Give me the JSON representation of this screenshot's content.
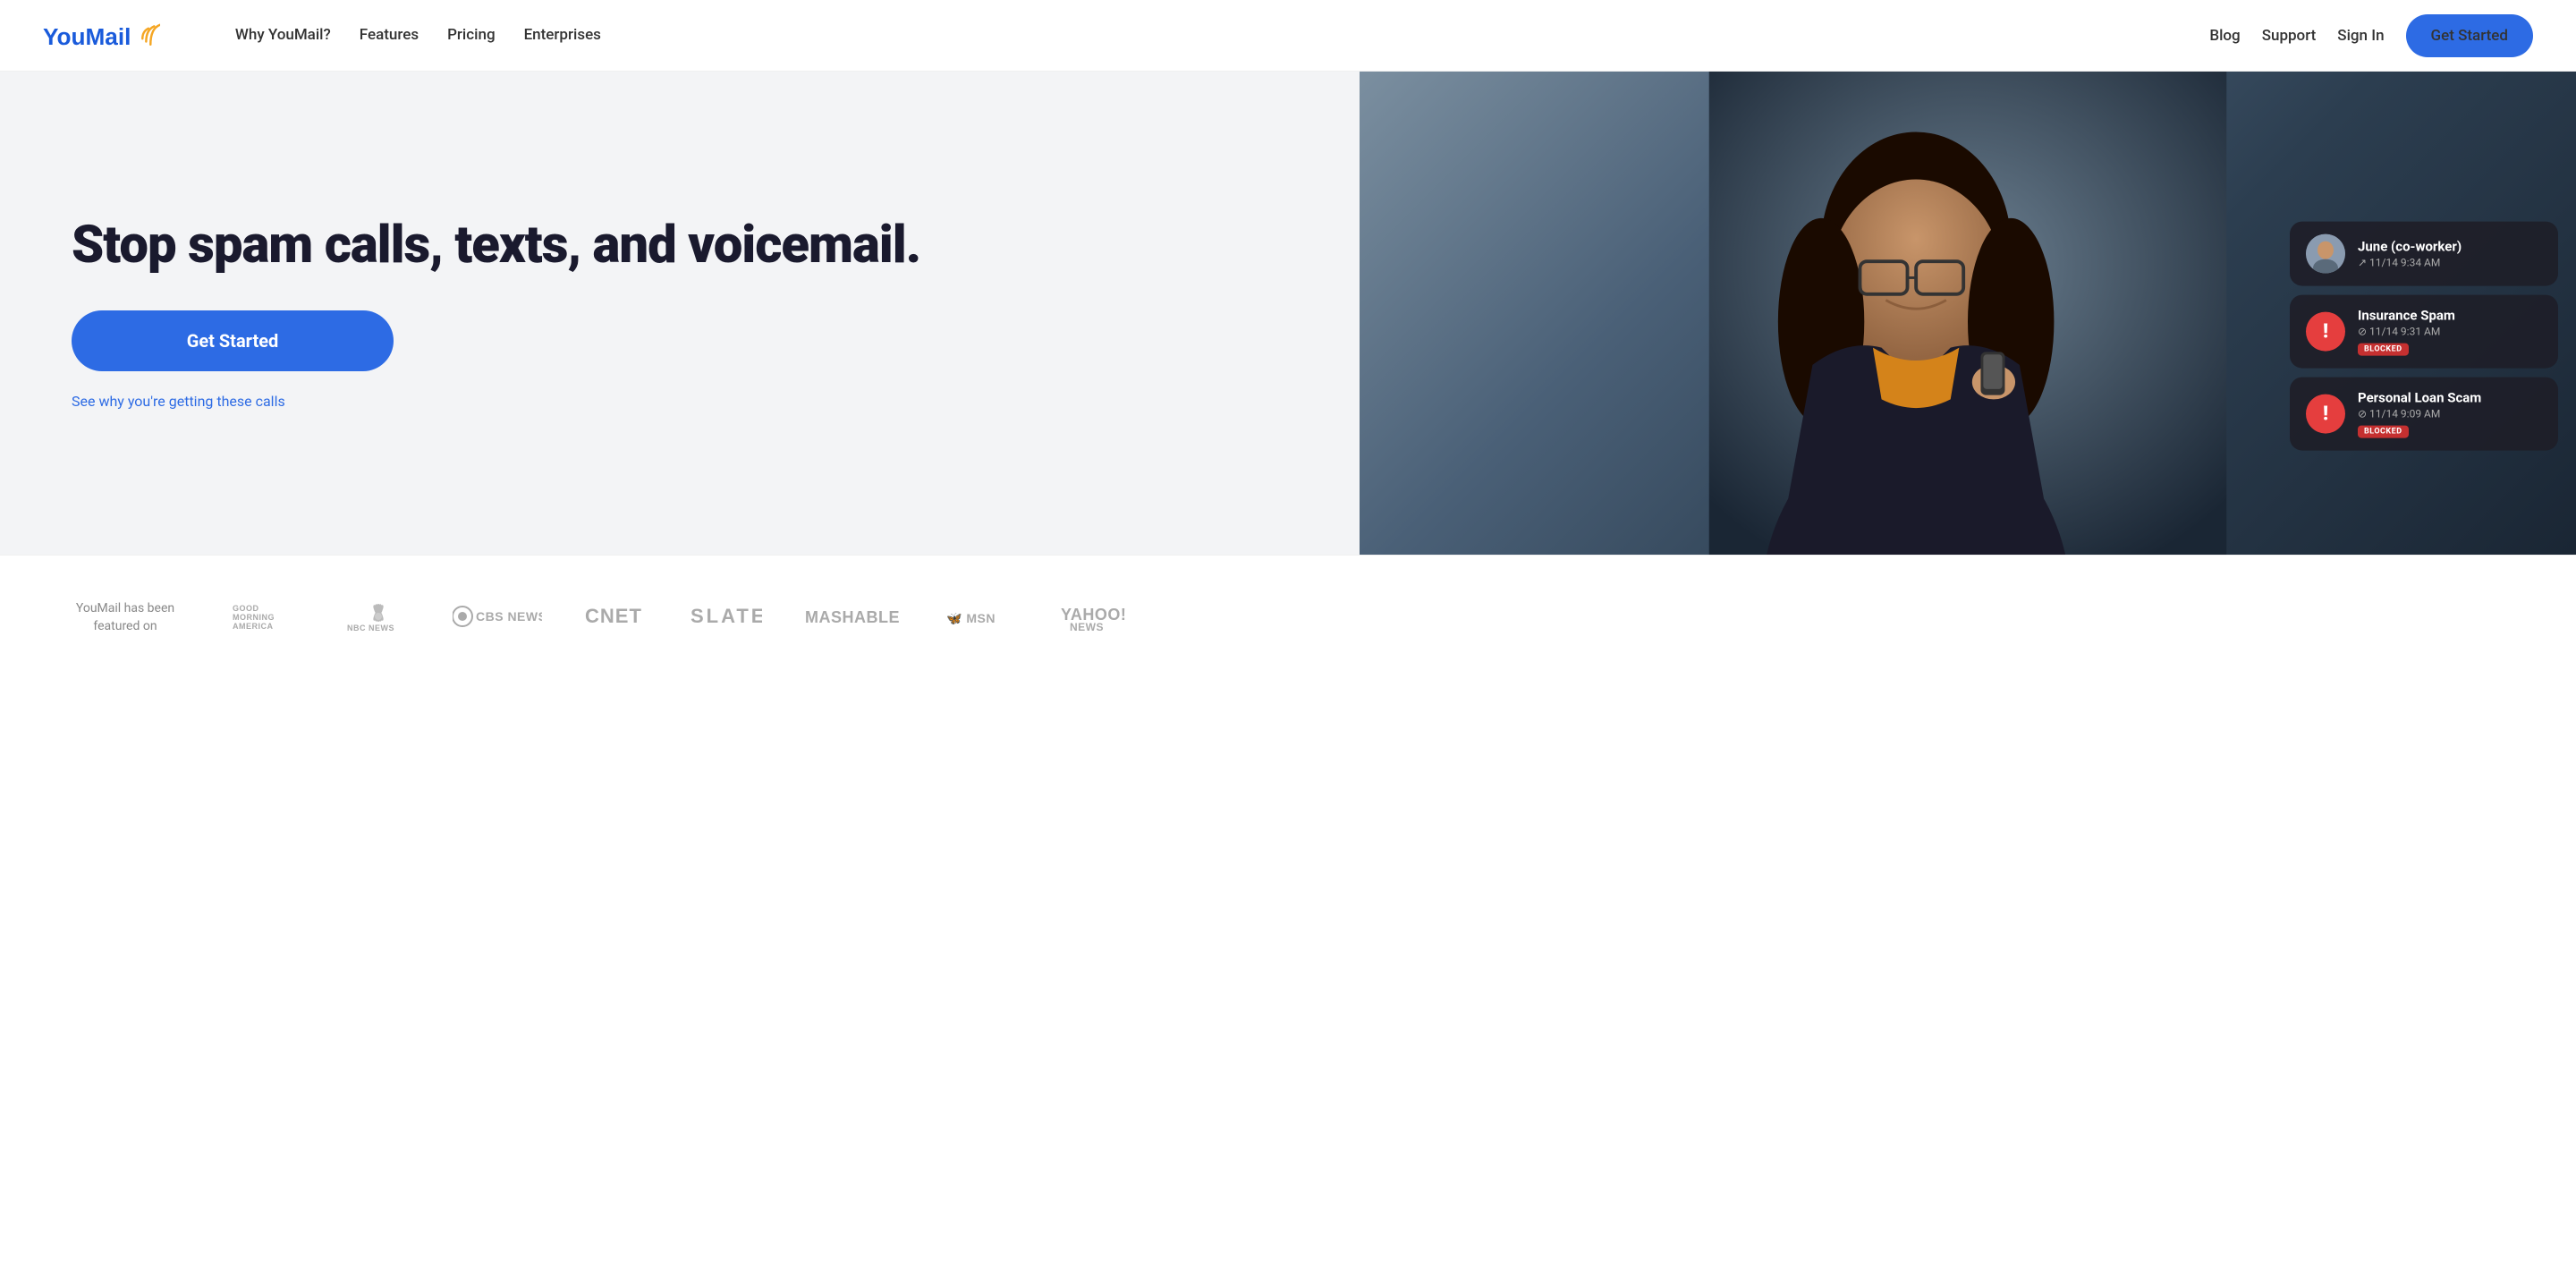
{
  "nav": {
    "logo_text": "YouMail",
    "links": [
      {
        "id": "why-youmail",
        "label": "Why YouMail?"
      },
      {
        "id": "features",
        "label": "Features"
      },
      {
        "id": "pricing",
        "label": "Pricing"
      },
      {
        "id": "enterprises",
        "label": "Enterprises"
      }
    ],
    "right_links": [
      {
        "id": "blog",
        "label": "Blog"
      },
      {
        "id": "support",
        "label": "Support"
      },
      {
        "id": "sign-in",
        "label": "Sign In"
      }
    ],
    "cta_label": "Get Started"
  },
  "hero": {
    "title": "Stop spam calls, texts, and voicemail.",
    "cta_label": "Get Started",
    "sublink_label": "See why you're getting these calls"
  },
  "call_cards": [
    {
      "id": "coworker-june",
      "type": "contact",
      "name": "June (co-worker)",
      "meta": "↗ 11/14  9:34 AM",
      "blocked": false
    },
    {
      "id": "insurance-spam",
      "type": "spam",
      "name": "Insurance Spam",
      "meta": "⊘ 11/14  9:31 AM",
      "blocked": true,
      "blocked_label": "BLOCKED"
    },
    {
      "id": "personal-loan-scam",
      "type": "spam",
      "name": "Personal Loan Scam",
      "meta": "⊘ 11/14  9:09 AM",
      "blocked": true,
      "blocked_label": "BLOCKED"
    }
  ],
  "featured": {
    "label": "YouMail has been featured on",
    "logos": [
      {
        "id": "gma",
        "label": "GOOD MORNING\nAMERICA"
      },
      {
        "id": "nbc",
        "label": "NBC NEWS"
      },
      {
        "id": "cbs",
        "label": "⊙CBS NEWS"
      },
      {
        "id": "cnet",
        "label": "CNET"
      },
      {
        "id": "slate",
        "label": "SLATE"
      },
      {
        "id": "mashable",
        "label": "Mashable"
      },
      {
        "id": "msn",
        "label": "🦋 msn"
      },
      {
        "id": "yahoo",
        "label": "yahoo!\nnews"
      }
    ]
  }
}
